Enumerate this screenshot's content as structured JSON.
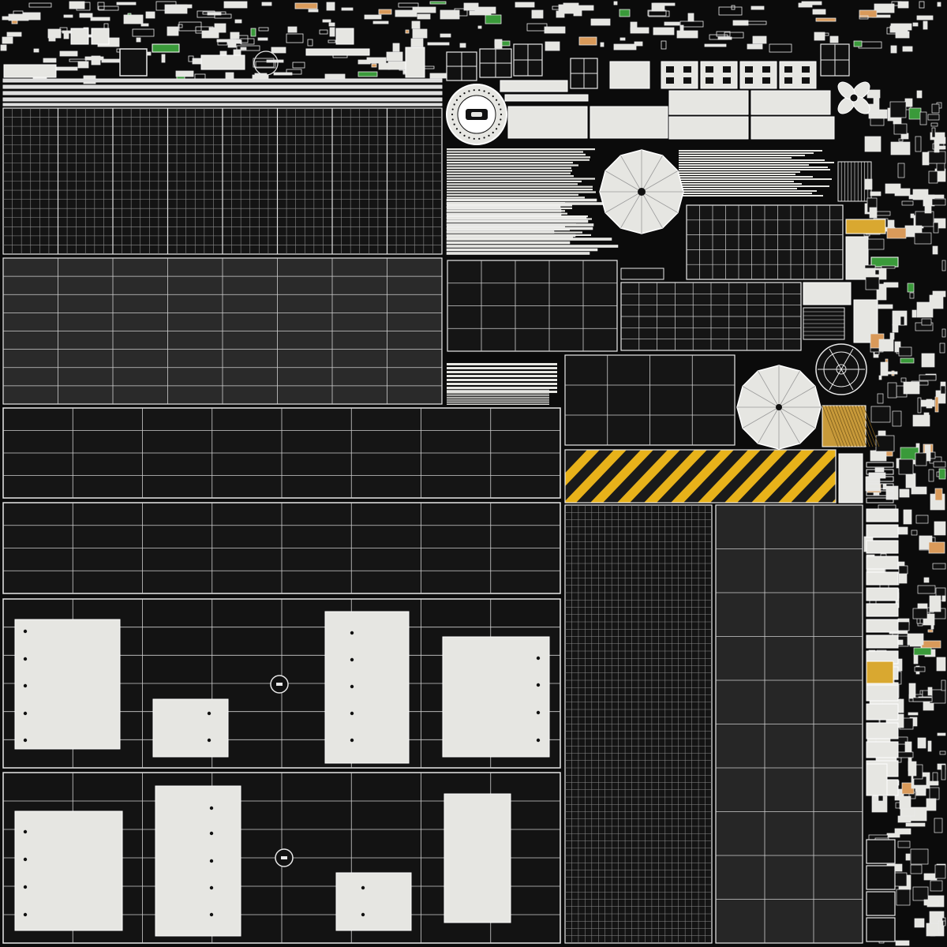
{
  "atlas": {
    "background": "#0b0b0b",
    "line_color": "#e8e8e8",
    "panel_fill": "#e6e6e2",
    "dark_fill": "#151515",
    "grey_fill": "#2a2a2a",
    "hazard_yellow": "#e8b21a",
    "accent_green": "#3a9a3a",
    "accent_orange": "#d99a5a",
    "text_labels": []
  }
}
